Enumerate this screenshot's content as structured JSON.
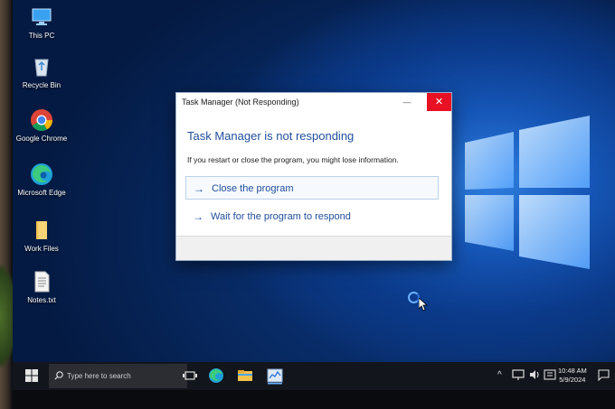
{
  "desktop": {
    "icons": [
      {
        "label": "This PC"
      },
      {
        "label": "Recycle Bin"
      },
      {
        "label": "Google Chrome"
      },
      {
        "label": "Microsoft Edge"
      },
      {
        "label": "Work Files"
      },
      {
        "label": "Notes.txt"
      }
    ]
  },
  "dialog": {
    "title": "Task Manager (Not Responding)",
    "minimize_glyph": "—",
    "close_glyph": "✕",
    "heading": "Task Manager is not responding",
    "message": "If you restart or close the program, you might lose information.",
    "options": [
      {
        "arrow": "→",
        "label": "Close the program"
      },
      {
        "arrow": "→",
        "label": "Wait for the program to respond"
      }
    ]
  },
  "taskbar": {
    "search_placeholder": "Type here to search",
    "tray": {
      "chevron": "^",
      "time": "10:48 AM",
      "date": "5/9/2024"
    }
  },
  "colors": {
    "accent": "#1f4e9c",
    "close_red": "#e81123",
    "taskbar": "#12151b"
  }
}
